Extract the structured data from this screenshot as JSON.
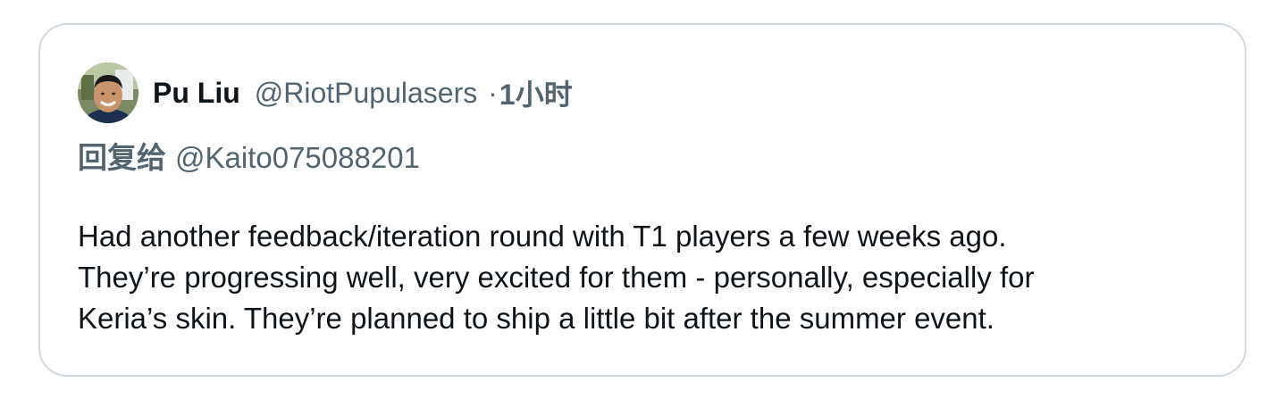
{
  "tweet": {
    "author_name": "Pu Liu",
    "author_handle": "@RiotPupulasers",
    "separator": "·",
    "time": "1小时",
    "reply_prefix": "回复给",
    "reply_to": "@Kaito075088201",
    "body_lines": [
      "Had another feedback/iteration round with T1 players a few weeks ago.",
      "They’re progressing well, very excited for them - personally, especially for",
      "Keria’s skin. They’re planned to ship a little bit after the summer event."
    ]
  },
  "colors": {
    "border": "#cfd9de",
    "primary_text": "#0f1419",
    "secondary_text": "#536471"
  },
  "icons": {
    "avatar": "profile-photo"
  }
}
